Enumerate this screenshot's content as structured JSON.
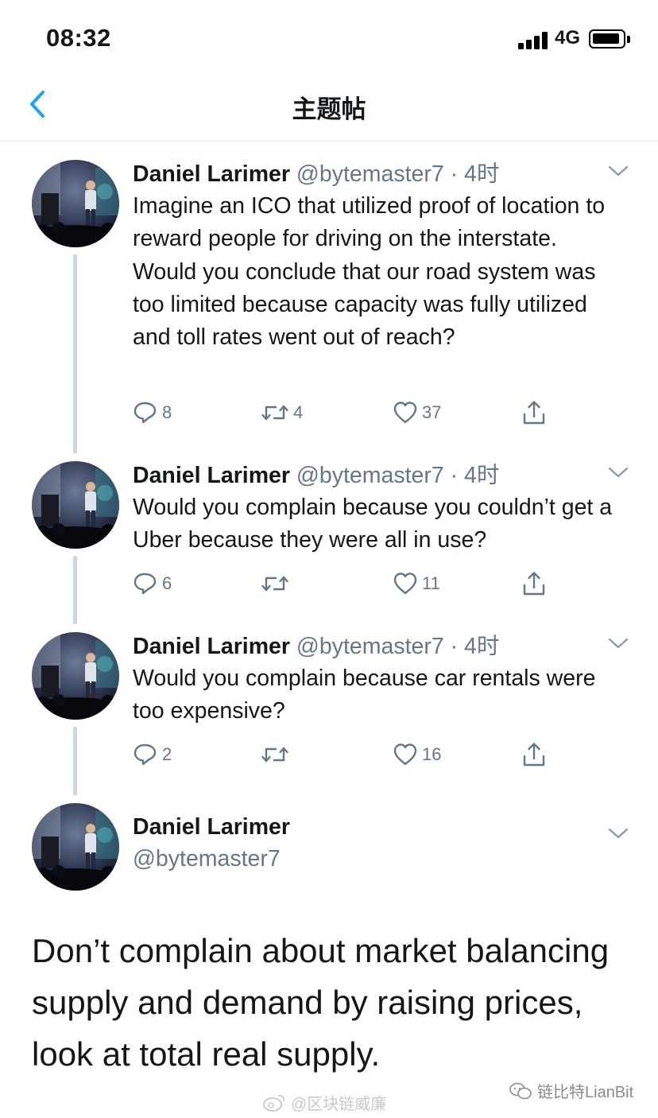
{
  "status_bar": {
    "time": "08:32",
    "network": "4G"
  },
  "nav": {
    "title": "主题帖"
  },
  "tweets": [
    {
      "name": "Daniel Larimer",
      "handle": "@bytemaster7",
      "separator": "·",
      "time": "4时",
      "text": "Imagine an ICO that utilized proof of location to reward people for driving on the interstate. Would you conclude that our road system was too limited because capacity was fully utilized and toll rates went out of reach?",
      "replies": "8",
      "retweets": "4",
      "likes": "37"
    },
    {
      "name": "Daniel Larimer",
      "handle": "@bytemaster7",
      "separator": "·",
      "time": "4时",
      "text": "Would you complain because you couldn’t get a Uber because they were all in use?",
      "replies": "6",
      "retweets": "",
      "likes": "11"
    },
    {
      "name": "Daniel Larimer",
      "handle": "@bytemaster7",
      "separator": "·",
      "time": "4时",
      "text": "Would you complain because car rentals were too expensive?",
      "replies": "2",
      "retweets": "",
      "likes": "16"
    }
  ],
  "main_tweet": {
    "name": "Daniel Larimer",
    "handle": "@bytemaster7",
    "text": "Don’t complain about market balancing supply and demand by raising prices, look at total real supply."
  },
  "watermarks": {
    "weibo": "@区块链威廉",
    "wechat": "链比特LianBit"
  },
  "colors": {
    "accent": "#1da1f2",
    "secondary_text": "#657786",
    "thread_line": "#ccd6dd"
  },
  "icons": [
    "back-chevron-icon",
    "reply-icon",
    "retweet-icon",
    "like-icon",
    "share-icon",
    "caret-down-icon",
    "signal-icon",
    "battery-icon",
    "weibo-logo-icon",
    "wechat-logo-icon"
  ]
}
